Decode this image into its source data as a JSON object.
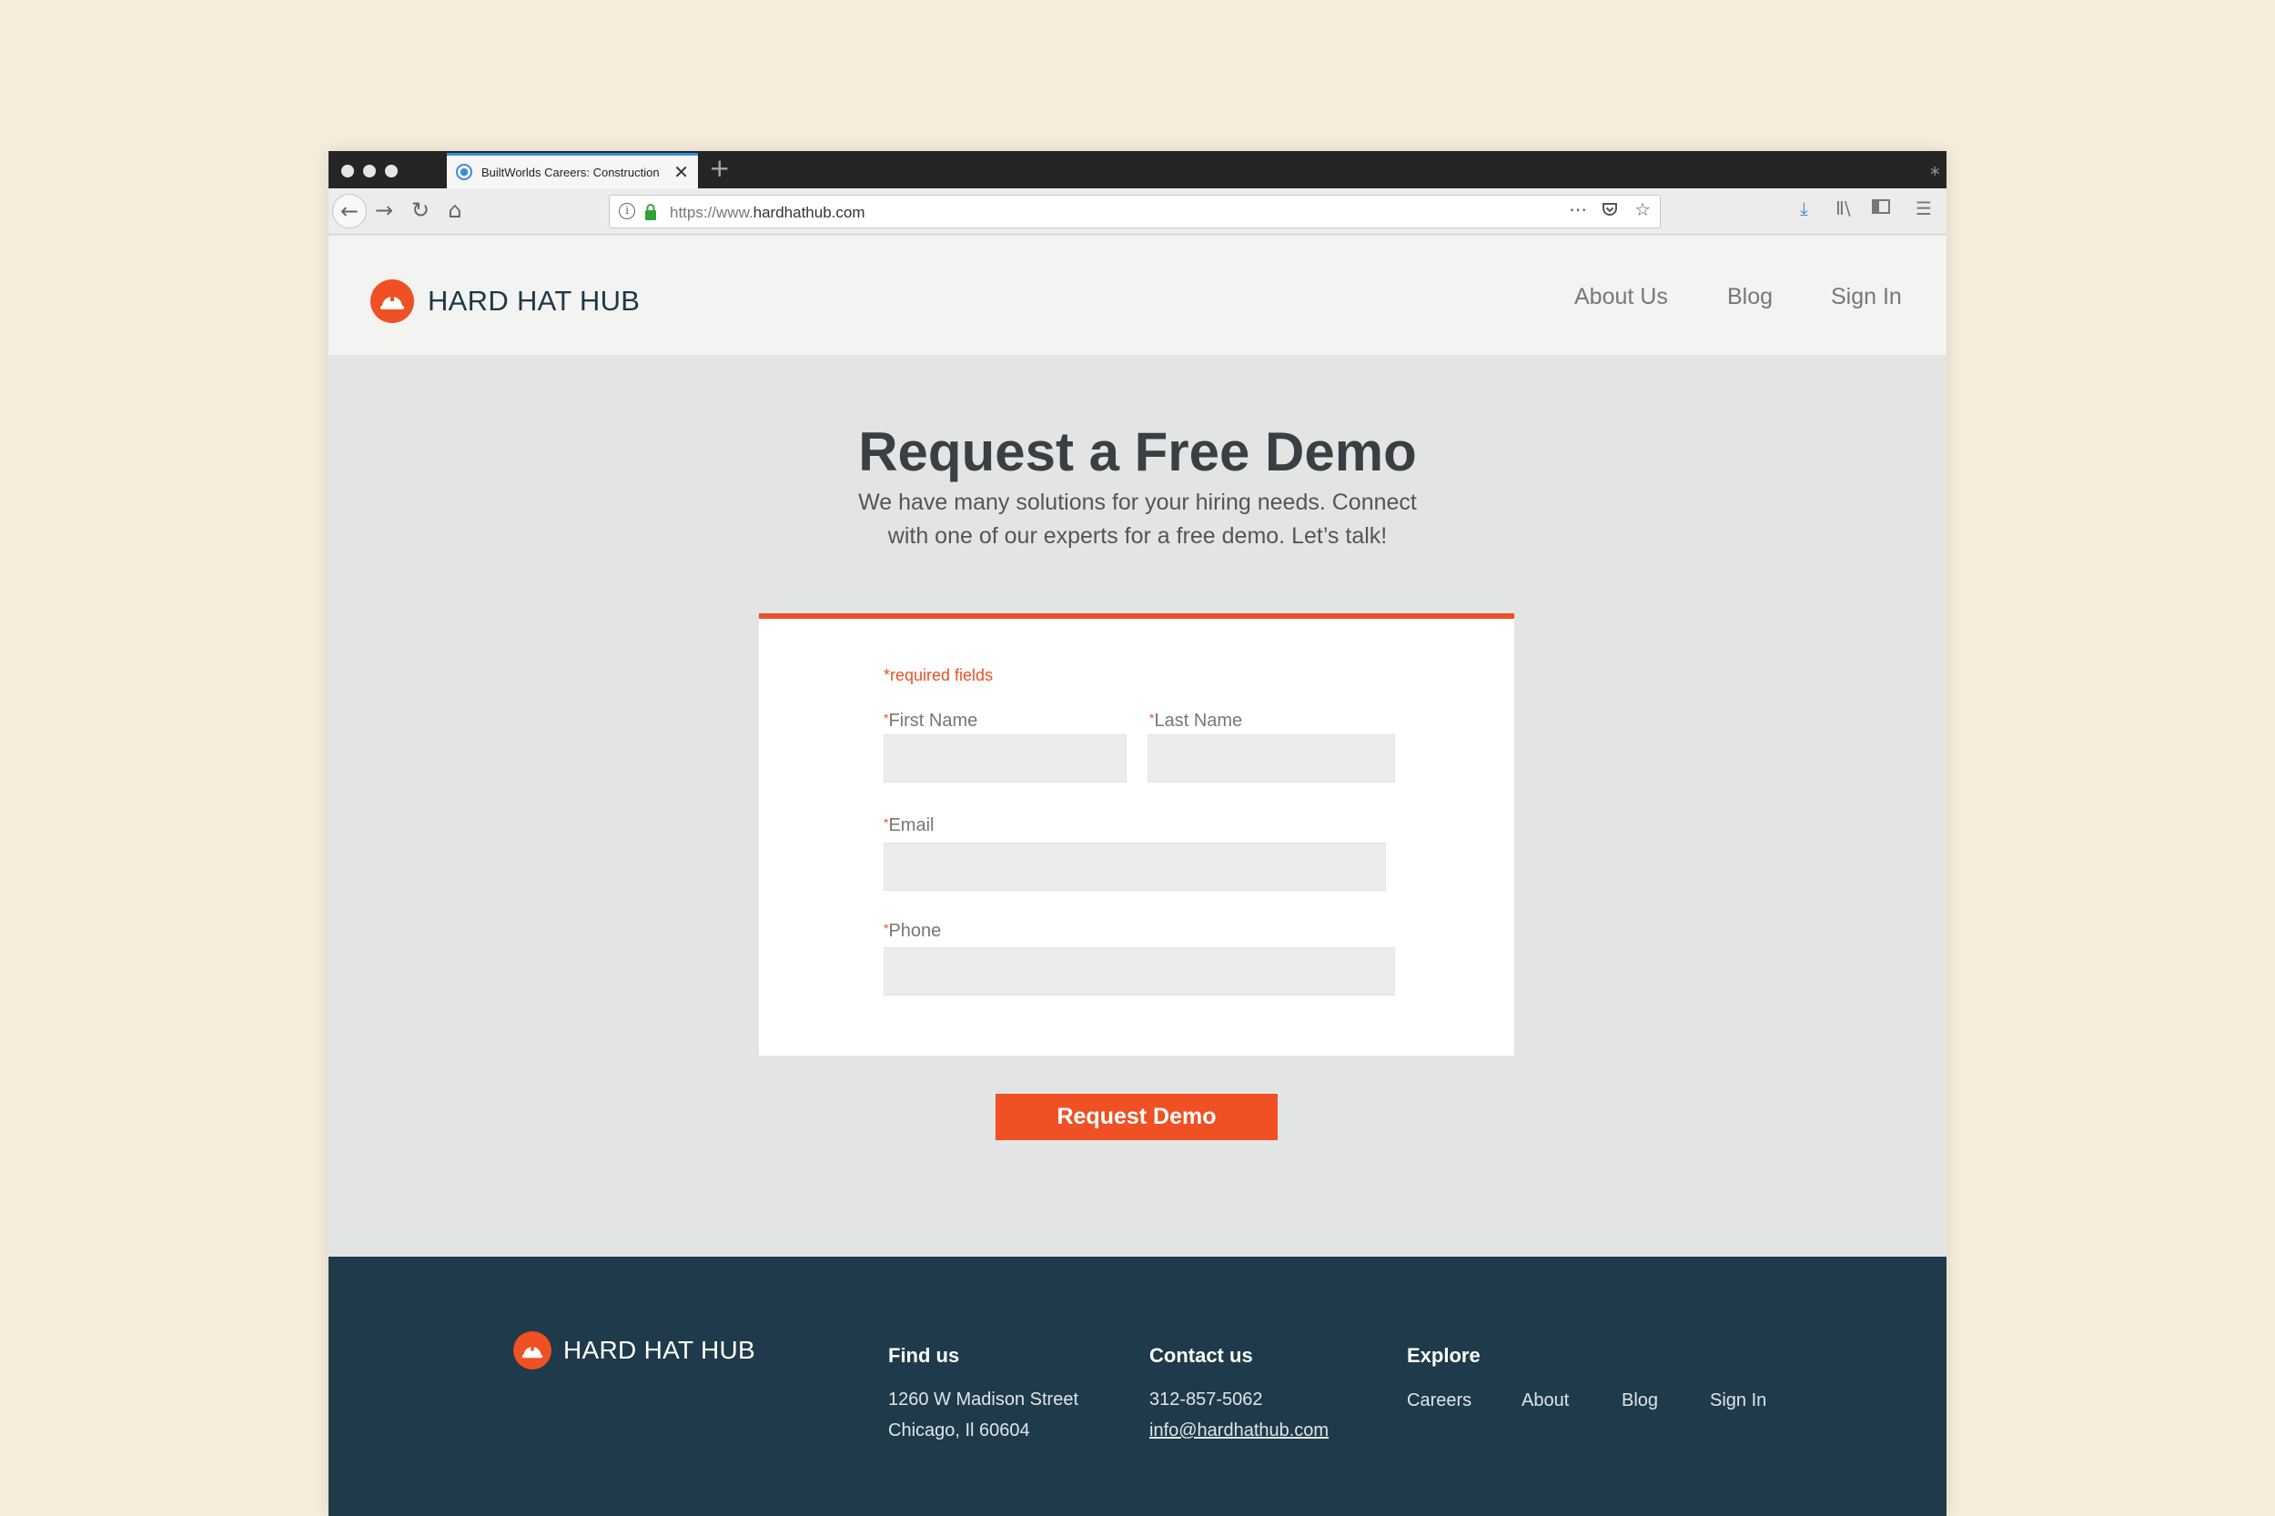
{
  "browser": {
    "tab_title": "BuiltWorlds Careers: Construction",
    "url_scheme": "https://www.",
    "url_host": "hardhathub.com"
  },
  "site": {
    "brand": "HARD HAT HUB",
    "nav": [
      "About Us",
      "Blog",
      "Sign In"
    ]
  },
  "hero": {
    "title": "Request a Free Demo",
    "subtitle_line1": "We have many solutions for your hiring needs. Connect",
    "subtitle_line2": "with one of our experts for a free demo. Let’s talk!"
  },
  "form": {
    "required_note": "*required fields",
    "star": "*",
    "first_name_label": "First Name",
    "first_name_value": "",
    "last_name_label": "Last Name",
    "last_name_value": "",
    "email_label": "Email",
    "email_value": "",
    "phone_label": "Phone",
    "phone_value": "",
    "submit": "Request Demo"
  },
  "footer": {
    "brand": "HARD HAT HUB",
    "find_us_heading": "Find us",
    "address_line1": "1260 W Madison Street",
    "address_line2": "Chicago, Il 60604",
    "contact_heading": "Contact us",
    "phone": "312-857-5062",
    "email": "info@hardhathub.com",
    "explore_heading": "Explore",
    "explore_links": [
      "Careers",
      "About",
      "Blog",
      "Sign In"
    ]
  },
  "colors": {
    "accent": "#ef5024",
    "footer_bg": "#1f3a4a",
    "page_bg": "#e3e5e5",
    "backdrop": "#f6eddd"
  },
  "icons": {
    "tab": "globe-icon",
    "logo": "hard-hat-icon",
    "url": [
      "info-icon",
      "lock-icon",
      "more-icon",
      "pocket-icon",
      "bookmark-star-icon"
    ],
    "toolbar": [
      "download-icon",
      "library-icon",
      "sidebar-icon",
      "menu-icon"
    ]
  }
}
